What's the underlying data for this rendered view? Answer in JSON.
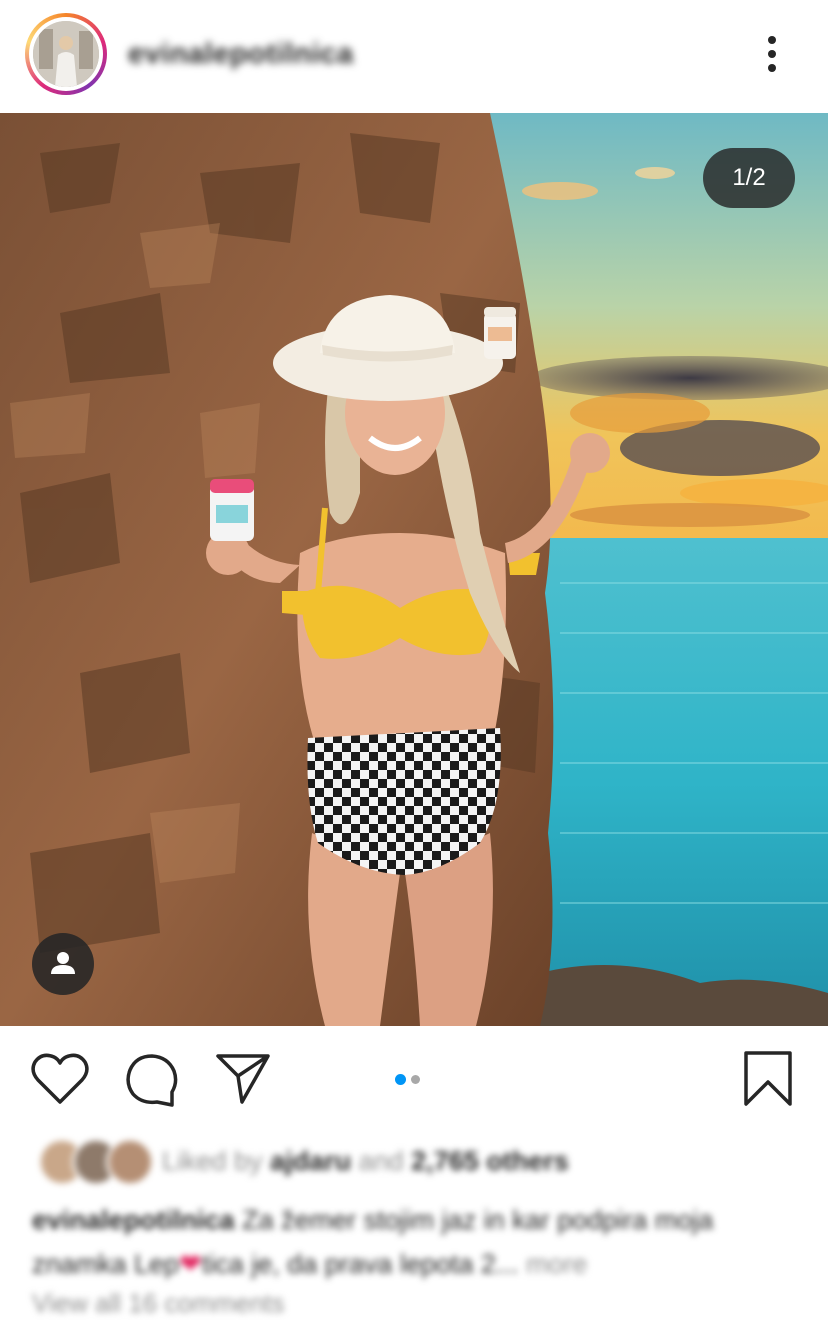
{
  "header": {
    "username": "evinalepotilnica",
    "more_icon": "more-vertical-icon"
  },
  "photo": {
    "counter": "1/2",
    "tag_icon": "user-tag-icon",
    "carousel_active_color": "#0095f6",
    "carousel_inactive_color": "#a8a8a8"
  },
  "actions": {
    "like_icon": "heart-icon",
    "comment_icon": "comment-icon",
    "share_icon": "share-icon",
    "save_icon": "bookmark-icon",
    "carousel_total": 2,
    "carousel_active": 1
  },
  "likes": {
    "prefix": "Liked by",
    "user": "ajdaru",
    "middle": "and",
    "count": "2,765 others"
  },
  "caption": {
    "username": "evinalepotilnica",
    "text_part1": "Za žemer stojim jaz in kar podpira moja znamka Lep",
    "heart": "❤",
    "text_part2": "tica je, da prava lepota 2...",
    "more": "more"
  },
  "comments": {
    "view_all": "View all 16 comments"
  }
}
